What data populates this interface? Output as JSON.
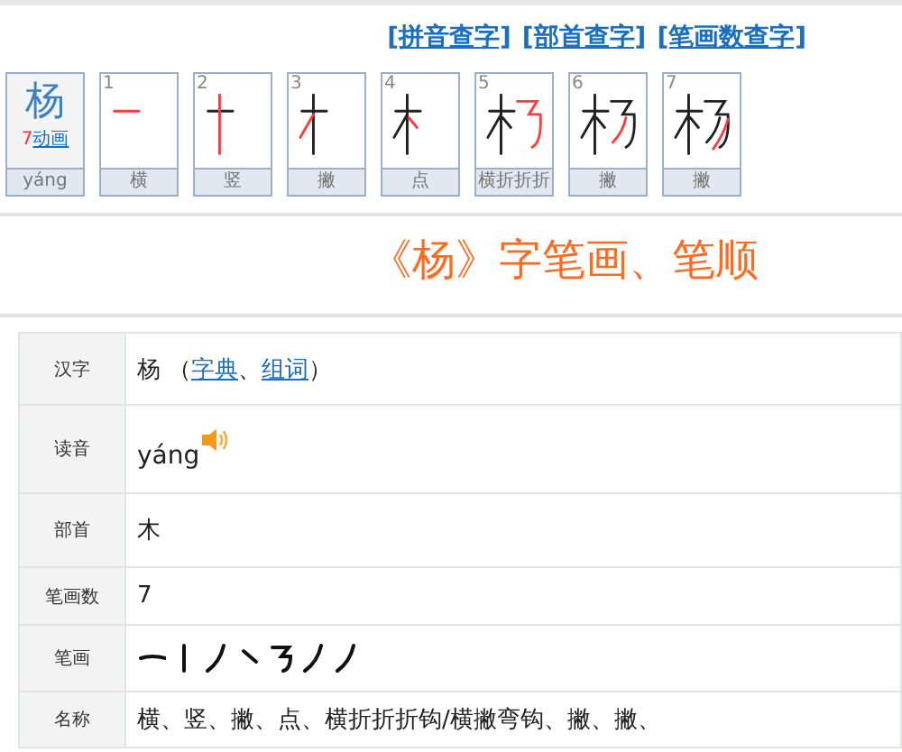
{
  "links": [
    "[拼音查字]",
    "[部首查字]",
    "[笔画数查字]"
  ],
  "summary": {
    "char": "杨",
    "count": "7",
    "animate": "动画",
    "pinyin": "yáng"
  },
  "frames": [
    {
      "number": "1",
      "label": "横"
    },
    {
      "number": "2",
      "label": "竖"
    },
    {
      "number": "3",
      "label": "撇"
    },
    {
      "number": "4",
      "label": "点"
    },
    {
      "number": "5",
      "label": "横折折折"
    },
    {
      "number": "6",
      "label": "撇"
    },
    {
      "number": "7",
      "label": "撇"
    }
  ],
  "title": "《杨》字笔画、笔顺",
  "rows": [
    {
      "label": "汉字",
      "kind": "links",
      "text": "杨",
      "open": "（",
      "links": [
        "字典",
        "组词"
      ],
      "separator": "、",
      "close": "）"
    },
    {
      "label": "读音",
      "kind": "audio",
      "text": "yáng"
    },
    {
      "label": "部首",
      "kind": "text",
      "text": "木"
    },
    {
      "label": "笔画数",
      "kind": "text",
      "text": "7"
    },
    {
      "label": "笔画",
      "kind": "strokes"
    },
    {
      "label": "名称",
      "kind": "text",
      "text": "横、竖、撇、点、横折折折钩/横撇弯钩、撇、撇、"
    }
  ]
}
